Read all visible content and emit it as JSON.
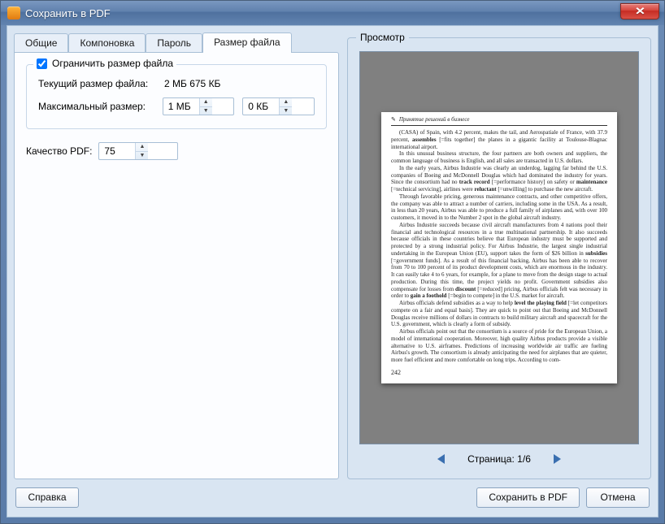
{
  "window": {
    "title": "Сохранить в PDF"
  },
  "tabs": [
    {
      "label": "Общие"
    },
    {
      "label": "Компоновка"
    },
    {
      "label": "Пароль"
    },
    {
      "label": "Размер файла"
    }
  ],
  "active_tab_index": 3,
  "limit_group": {
    "checkbox_checked": true,
    "legend": "Ограничить размер файла",
    "current_size_label": "Текущий размер файла:",
    "current_size_value": "2 МБ 675 КБ",
    "max_size_label": "Максимальный размер:",
    "max_mb_value": "1 МБ",
    "max_kb_value": "0 КБ"
  },
  "quality": {
    "label": "Качество PDF:",
    "value": "75"
  },
  "preview": {
    "legend": "Просмотр",
    "page_label": "Страница:",
    "page_current": 1,
    "page_total": 6,
    "page_number_rendered": "242",
    "running_head": "Принятие решений в бизнесе"
  },
  "footer": {
    "help": "Справка",
    "save": "Сохранить в PDF",
    "cancel": "Отмена"
  }
}
